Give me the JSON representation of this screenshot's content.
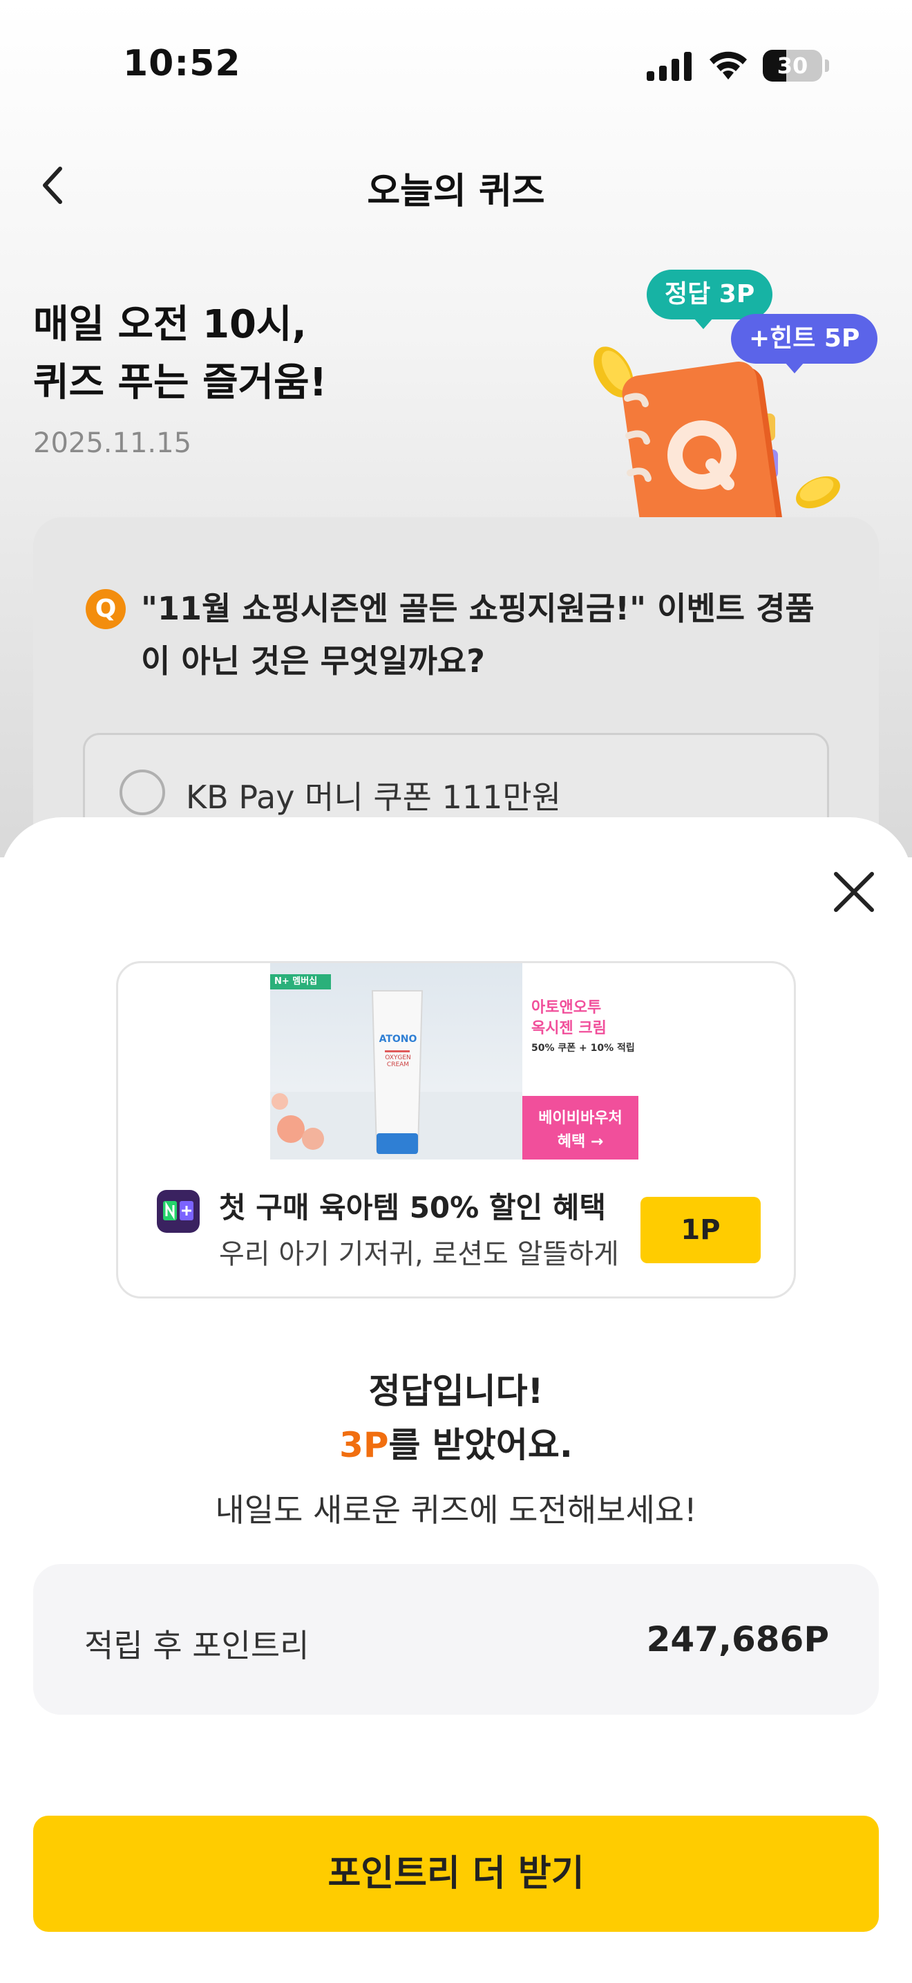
{
  "status_bar": {
    "time": "10:52",
    "battery": "30"
  },
  "header": {
    "title": "오늘의 퀴즈"
  },
  "hero": {
    "title": "매일 오전 10시,\n퀴즈 푸는 즐거움!",
    "date": "2025.11.15",
    "bubble_answer": "정답 3P",
    "bubble_hint": "+힌트 5P"
  },
  "quiz": {
    "badge": "Q",
    "question": "\"11월 쇼핑시즌엔 골든 쇼핑지원금!\" 이벤트 경품이 아닌 것은 무엇일까요?",
    "option_label": "KB Pay 머니 쿠폰 111만원"
  },
  "ad": {
    "image_title_1": "아토앤오투",
    "image_title_2": "옥시젠 크림",
    "image_sub": "50% 쿠폰 + 10% 적립",
    "image_tag": "N+ 멤버십",
    "product_brand": "ATONO",
    "product_name": "OXYGEN CREAM",
    "image_btn_1": "베이비바우처",
    "image_btn_2": "혜택 →",
    "title": "첫 구매 육아템 50% 할인 혜택",
    "description": "우리 아기 기저귀, 로션도 알뜰하게",
    "button": "1P"
  },
  "result": {
    "line1": "정답입니다!",
    "points": "3P",
    "line2_suffix": "를 받았어요.",
    "line3": "내일도 새로운 퀴즈에 도전해보세요!"
  },
  "total": {
    "label": "적립 후 포인트리",
    "value": "247,686P"
  },
  "cta": {
    "label": "포인트리 더 받기"
  },
  "colors": {
    "accent_yellow": "#ffcc00",
    "points_orange": "#f16e0f",
    "teal_bubble": "#17b3a4",
    "purple_bubble": "#5b64e9",
    "notebook_orange": "#f47a3a"
  }
}
